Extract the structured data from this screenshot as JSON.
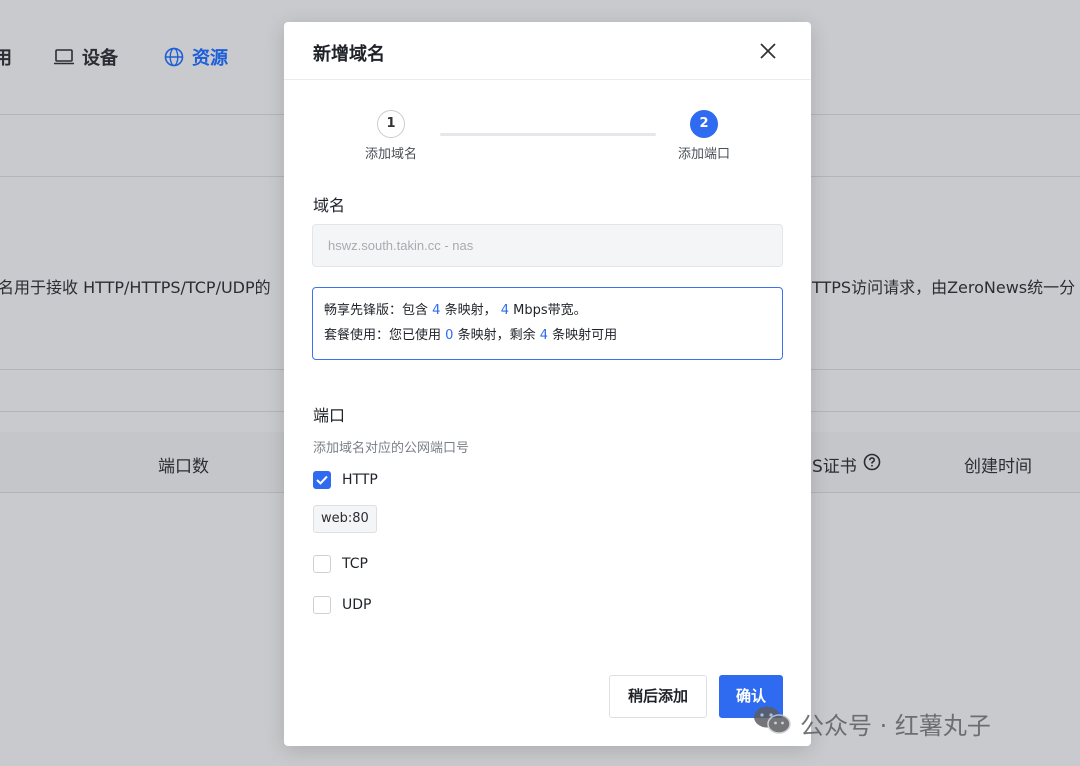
{
  "background": {
    "nav": [
      {
        "label": "用",
        "icon": "partial-icon"
      },
      {
        "label": "设备",
        "icon": "laptop-icon"
      },
      {
        "label": "资源",
        "icon": "globe-icon",
        "active": true
      }
    ],
    "description_left": "名用于接收 HTTP/HTTPS/TCP/UDP的",
    "description_right": "TTPS访问请求，由ZeroNews统一分",
    "table_headers": {
      "ports": "端口数",
      "cert": "S证书",
      "created": "创建时间"
    }
  },
  "modal": {
    "title": "新增域名",
    "steps": [
      {
        "number": "1",
        "label": "添加域名",
        "state": "done"
      },
      {
        "number": "2",
        "label": "添加端口",
        "state": "current"
      }
    ],
    "domain_label": "域名",
    "domain_value": "hswz.south.takin.cc - nas",
    "info": {
      "line1_prefix": "畅享先锋版：包含",
      "line1_mappings": "4",
      "line1_mid": "条映射，",
      "line1_bandwidth": "4",
      "line1_suffix": "Mbps带宽。",
      "line2_prefix": "套餐使用：您已使用",
      "line2_used": "0",
      "line2_mid": "条映射，剩余",
      "line2_remaining": "4",
      "line2_suffix": "条映射可用"
    },
    "port_label": "端口",
    "port_hint": "添加域名对应的公网端口号",
    "protocols": [
      {
        "name": "HTTP",
        "checked": true
      },
      {
        "name": "TCP",
        "checked": false
      },
      {
        "name": "UDP",
        "checked": false
      }
    ],
    "http_tag": "web:80",
    "buttons": {
      "later": "稍后添加",
      "confirm": "确认"
    }
  },
  "watermark": "公众号 · 红薯丸子",
  "colors": {
    "accent": "#2f6bf0",
    "overlay_bg": "#c9cacd"
  }
}
